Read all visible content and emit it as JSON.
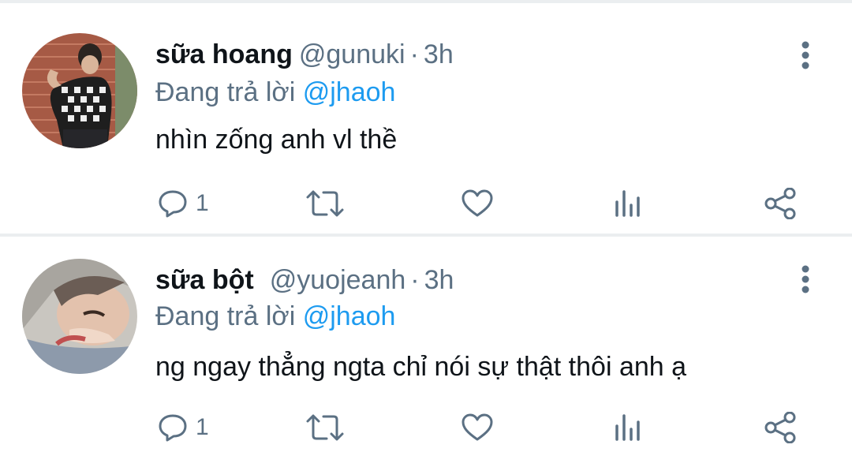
{
  "colors": {
    "text": "#0f1419",
    "secondary": "#5b7083",
    "link": "#1d9bf0",
    "divider": "#ebeef0"
  },
  "tweets": [
    {
      "name": "sữa hoang",
      "handle": "@gunuki",
      "separator": "·",
      "time": "3h",
      "reply_prefix": "Đang trả lời",
      "reply_to": "@jhaoh",
      "text": "nhìn zống anh vl thề",
      "reply_count": "1",
      "icons": [
        "reply-icon",
        "retweet-icon",
        "like-icon",
        "analytics-icon",
        "share-icon",
        "more-icon"
      ]
    },
    {
      "name": "sữa bột",
      "handle": "@yuojeanh",
      "separator": "·",
      "time": "3h",
      "reply_prefix": "Đang trả lời",
      "reply_to": "@jhaoh",
      "text": "ng ngay thẳng ngta chỉ nói sự thật thôi anh ạ",
      "reply_count": "1",
      "icons": [
        "reply-icon",
        "retweet-icon",
        "like-icon",
        "analytics-icon",
        "share-icon",
        "more-icon"
      ]
    }
  ]
}
